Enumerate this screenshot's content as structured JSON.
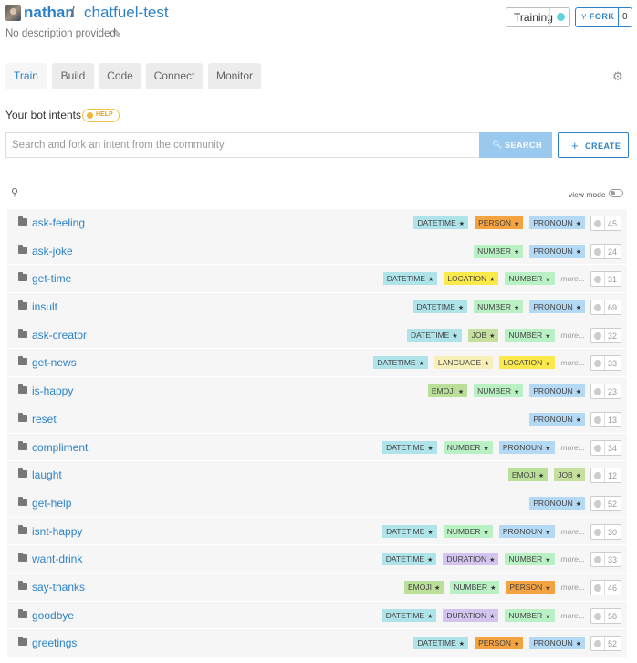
{
  "header": {
    "owner": "nathan",
    "separator": "/",
    "repo": "chatfuel-test",
    "description": "No description provided",
    "training_label": "Training",
    "fork_label": "FORK",
    "fork_count": "0"
  },
  "tabs": [
    {
      "label": "Train",
      "active": true
    },
    {
      "label": "Build",
      "active": false
    },
    {
      "label": "Code",
      "active": false
    },
    {
      "label": "Connect",
      "active": false
    },
    {
      "label": "Monitor",
      "active": false
    }
  ],
  "intents_section": {
    "title": "Your bot intents",
    "help_label": "HELP",
    "search_placeholder": "Search and fork an intent from the community",
    "search_button": "SEARCH",
    "create_button": "CREATE",
    "view_mode_label": "view mode"
  },
  "colors": {
    "link": "#2c82c9",
    "tag_datetime": "#aee3ea",
    "tag_person": "#f4a340",
    "tag_pronoun": "#b3d9f5",
    "tag_number": "#b9f0c4",
    "tag_location": "#fbe94b",
    "tag_job": "#c6df9c",
    "tag_language": "#f7f0b8",
    "tag_emoji": "#b9df98",
    "tag_duration": "#d2c4ee"
  },
  "more_label": "more...",
  "intents": [
    {
      "name": "ask-feeling",
      "tags": [
        "DATETIME",
        "PERSON",
        "PRONOUN"
      ],
      "more": false,
      "count": "45"
    },
    {
      "name": "ask-joke",
      "tags": [
        "NUMBER",
        "PRONOUN"
      ],
      "more": false,
      "count": "24"
    },
    {
      "name": "get-time",
      "tags": [
        "DATETIME",
        "LOCATION",
        "NUMBER"
      ],
      "more": true,
      "count": "31"
    },
    {
      "name": "insult",
      "tags": [
        "DATETIME",
        "NUMBER",
        "PRONOUN"
      ],
      "more": false,
      "count": "69"
    },
    {
      "name": "ask-creator",
      "tags": [
        "DATETIME",
        "JOB",
        "NUMBER"
      ],
      "more": true,
      "count": "32"
    },
    {
      "name": "get-news",
      "tags": [
        "DATETIME",
        "LANGUAGE",
        "LOCATION"
      ],
      "more": true,
      "count": "33"
    },
    {
      "name": "is-happy",
      "tags": [
        "EMOJI",
        "NUMBER",
        "PRONOUN"
      ],
      "more": false,
      "count": "23"
    },
    {
      "name": "reset",
      "tags": [
        "PRONOUN"
      ],
      "more": false,
      "count": "13"
    },
    {
      "name": "compliment",
      "tags": [
        "DATETIME",
        "NUMBER",
        "PRONOUN"
      ],
      "more": true,
      "count": "34"
    },
    {
      "name": "laught",
      "tags": [
        "EMOJI",
        "JOB"
      ],
      "more": false,
      "count": "12"
    },
    {
      "name": "get-help",
      "tags": [
        "PRONOUN"
      ],
      "more": false,
      "count": "52"
    },
    {
      "name": "isnt-happy",
      "tags": [
        "DATETIME",
        "NUMBER",
        "PRONOUN"
      ],
      "more": true,
      "count": "30"
    },
    {
      "name": "want-drink",
      "tags": [
        "DATETIME",
        "DURATION",
        "NUMBER"
      ],
      "more": true,
      "count": "33"
    },
    {
      "name": "say-thanks",
      "tags": [
        "EMOJI",
        "NUMBER",
        "PERSON"
      ],
      "more": true,
      "count": "46"
    },
    {
      "name": "goodbye",
      "tags": [
        "DATETIME",
        "DURATION",
        "NUMBER"
      ],
      "more": true,
      "count": "58"
    },
    {
      "name": "greetings",
      "tags": [
        "DATETIME",
        "PERSON",
        "PRONOUN"
      ],
      "more": false,
      "count": "52"
    }
  ]
}
